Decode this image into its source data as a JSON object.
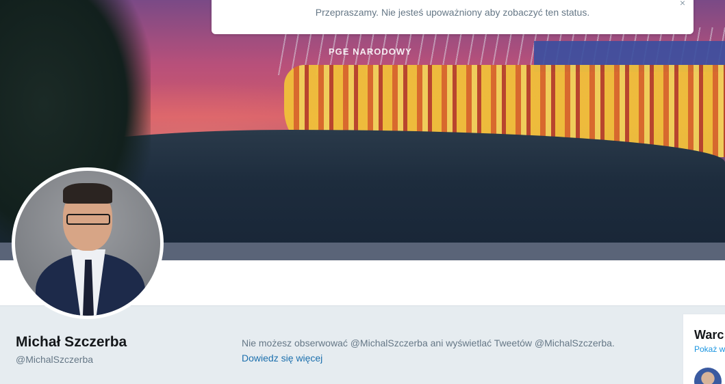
{
  "toast": {
    "message": "Przepraszamy. Nie jesteś upoważniony aby zobaczyć ten status.",
    "close_label": "×"
  },
  "banner": {
    "sign_text": "PGE NARODOWY"
  },
  "profile": {
    "name": "Michał Szczerba",
    "handle": "@MichalSzczerba",
    "protected_notice": "Nie możesz obserwować @MichalSzczerba ani wyświetlać Tweetów @MichalSzczerba.",
    "learn_more": "Dowiedz się więcej"
  },
  "right_card": {
    "title": "Warc",
    "link": "Pokaż w"
  },
  "colors": {
    "link_blue": "#1b6fad",
    "muted_text": "#657786",
    "background": "#e6ecf0"
  }
}
